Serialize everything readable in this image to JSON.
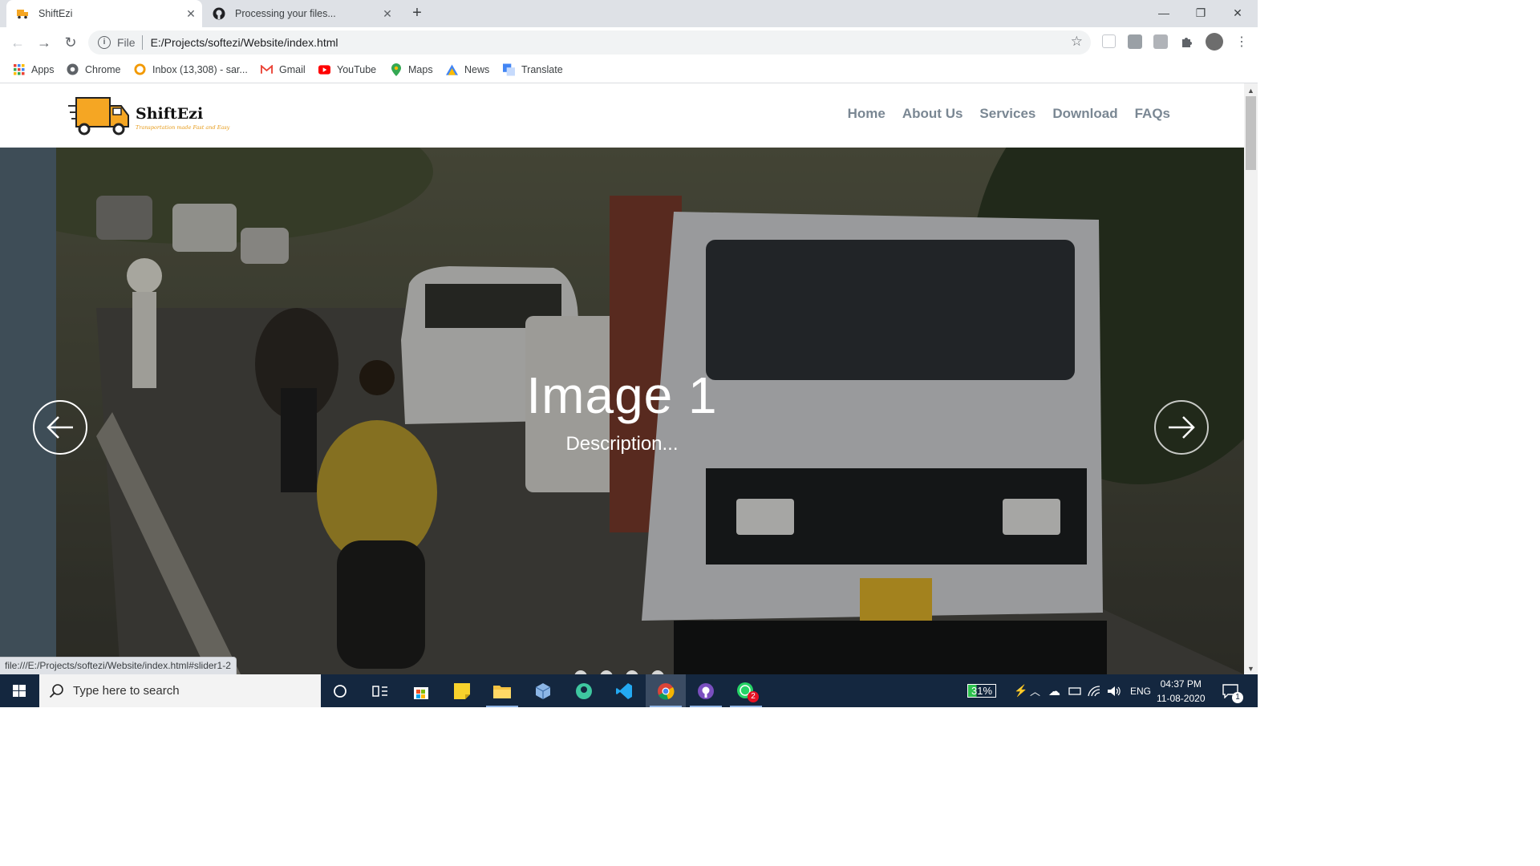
{
  "browser": {
    "tabs": [
      {
        "title": "ShiftEzi",
        "active": true,
        "icon": "shiftezi-favicon"
      },
      {
        "title": "Processing your files...",
        "active": false,
        "icon": "github-icon"
      }
    ],
    "address": {
      "scheme_label": "File",
      "url": "E:/Projects/softezi/Website/index.html"
    },
    "bookmarks": [
      {
        "label": "Apps",
        "icon": "apps-grid-icon"
      },
      {
        "label": "Chrome",
        "icon": "chrome-icon"
      },
      {
        "label": "Inbox (13,308) - sar...",
        "icon": "inbox-icon"
      },
      {
        "label": "Gmail",
        "icon": "gmail-icon"
      },
      {
        "label": "YouTube",
        "icon": "youtube-icon"
      },
      {
        "label": "Maps",
        "icon": "maps-icon"
      },
      {
        "label": "News",
        "icon": "news-icon"
      },
      {
        "label": "Translate",
        "icon": "translate-icon"
      }
    ],
    "status_url": "file:///E:/Projects/softezi/Website/index.html#slider1-2"
  },
  "site": {
    "brand": "ShiftEzi",
    "tagline": "Transportation made Fast and Easy",
    "nav": [
      "Home",
      "About Us",
      "Services",
      "Download",
      "FAQs"
    ],
    "slide": {
      "title": "Image 1",
      "description": "Description..."
    },
    "slide_count": 4
  },
  "taskbar": {
    "search_placeholder": "Type here to search",
    "battery": "31%",
    "language": "ENG",
    "time": "04:37 PM",
    "date": "11-08-2020",
    "whatsapp_badge": "2",
    "notifications_badge": "1"
  },
  "colors": {
    "tab_strip": "#dee1e6",
    "nav_link": "#7a8793",
    "logo_orange": "#f5a623",
    "taskbar": "#14273f"
  }
}
